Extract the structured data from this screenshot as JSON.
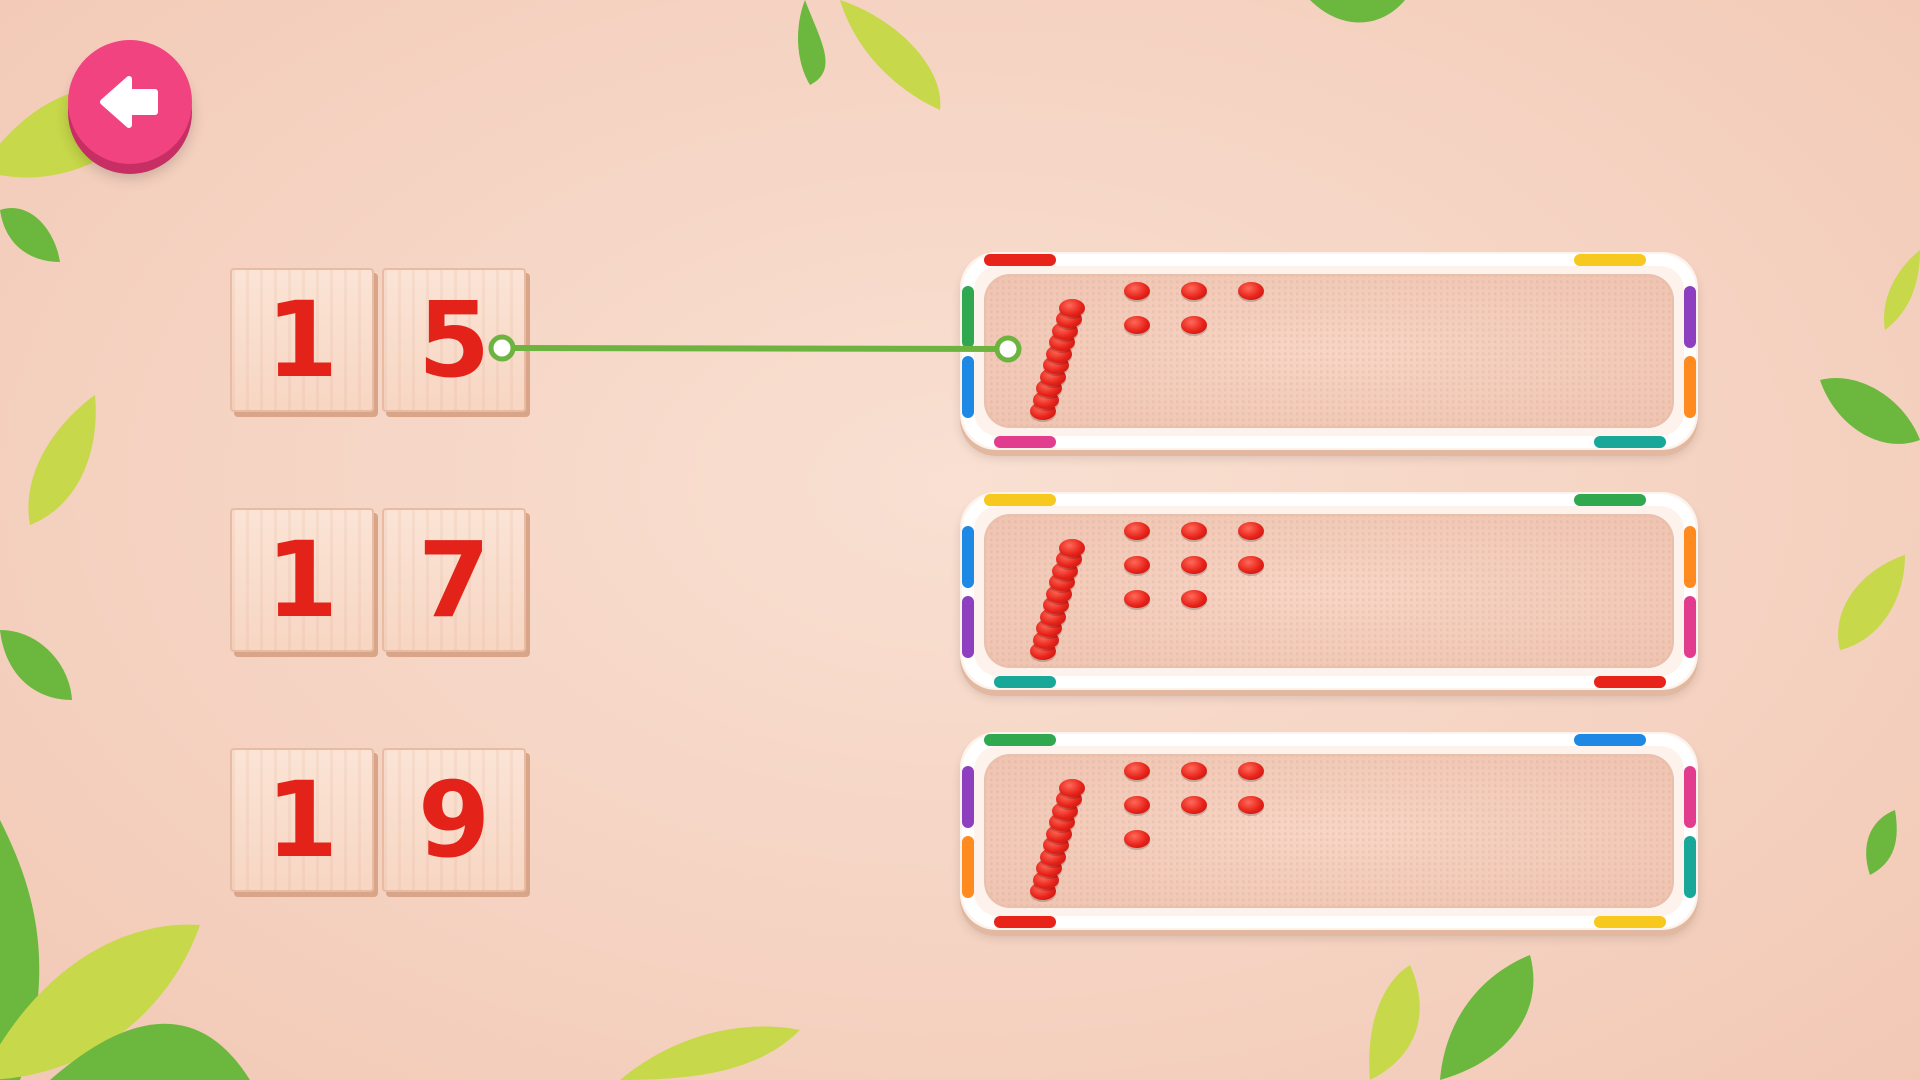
{
  "back_button": {
    "icon": "back-arrow-icon"
  },
  "number_cards": [
    {
      "tens": "1",
      "ones": "5"
    },
    {
      "tens": "1",
      "ones": "7"
    },
    {
      "tens": "1",
      "ones": "9"
    }
  ],
  "bead_trays": [
    {
      "ten_rods": 1,
      "unit_beads": 5
    },
    {
      "ten_rods": 1,
      "unit_beads": 8
    },
    {
      "ten_rods": 1,
      "unit_beads": 7
    }
  ],
  "connection": {
    "from_card": 0,
    "to_tray": 0
  },
  "colors": {
    "background": "#f6d6c6",
    "back_button": "#f0437f",
    "digit": "#e32319",
    "bead": "#e8231a",
    "link_line": "#6db33f",
    "leaf_dark": "#6cb83e",
    "leaf_light": "#c7d84a"
  }
}
